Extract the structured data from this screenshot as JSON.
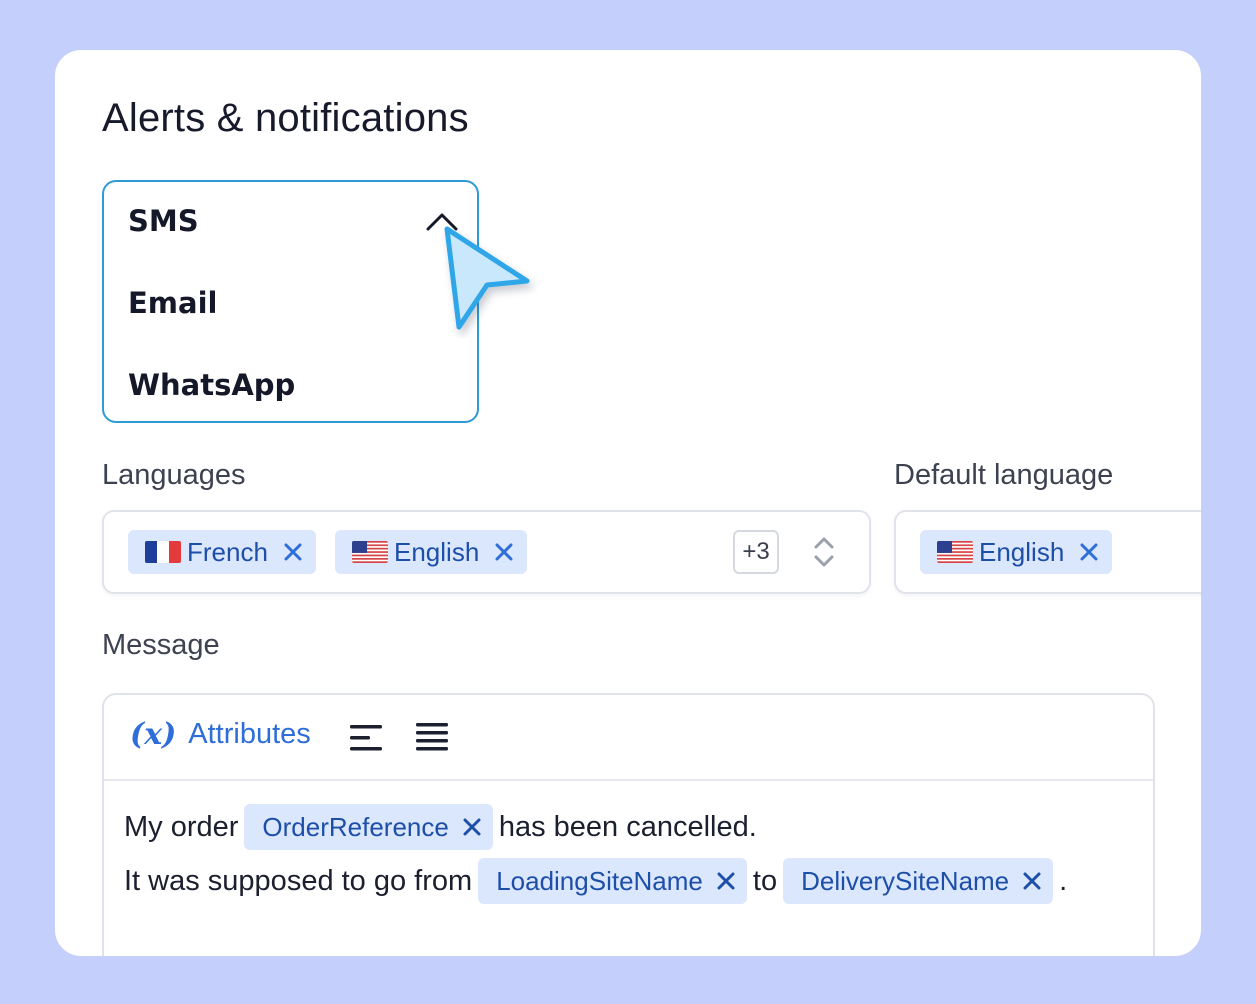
{
  "page": {
    "title": "Alerts & notifications"
  },
  "channel_dropdown": {
    "options": [
      "SMS",
      "Email",
      "WhatsApp"
    ],
    "selected": "SMS",
    "expanded": true
  },
  "languages": {
    "label": "Languages",
    "chips": [
      {
        "label": "French",
        "flag": "fr-flag-icon"
      },
      {
        "label": "English",
        "flag": "us-flag-icon"
      }
    ],
    "more_count": "+3"
  },
  "default_language": {
    "label": "Default language",
    "chip": {
      "label": "English",
      "flag": "us-flag-icon"
    }
  },
  "message": {
    "label": "Message",
    "toolbar": {
      "attributes_label": "Attributes",
      "fx_symbol": "(x)"
    },
    "line1": {
      "before": "My order",
      "tag": "OrderReference",
      "after": "has been cancelled."
    },
    "line2": {
      "before": "It was supposed to go from",
      "tag1": "LoadingSiteName",
      "middle": "to",
      "tag2": "DeliverySiteName",
      "after": "."
    }
  },
  "colors": {
    "background": "#c5cffb",
    "accent": "#2e9bd6",
    "chip_bg": "#dbe7fd",
    "chip_text": "#1e4fa8",
    "link": "#2f6ed8"
  }
}
